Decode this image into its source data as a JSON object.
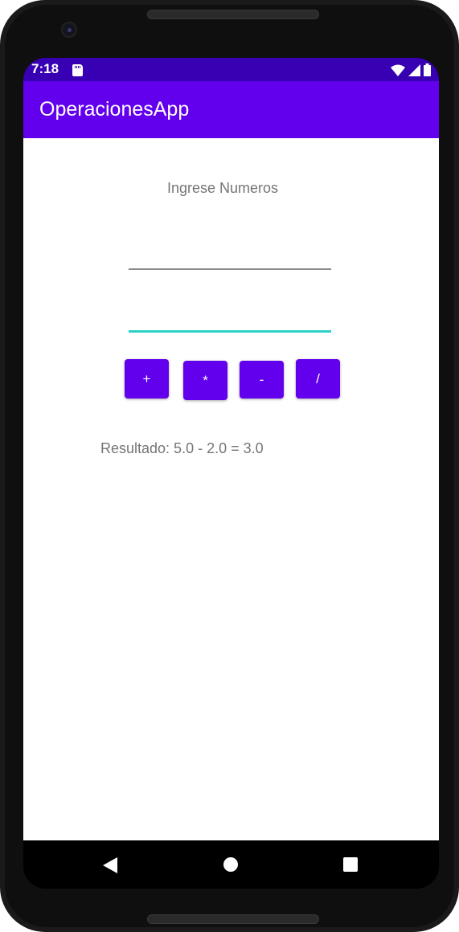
{
  "status_bar": {
    "time": "7:18",
    "icons": [
      "sd-card-icon",
      "wifi-icon",
      "signal-icon",
      "battery-icon"
    ]
  },
  "app_bar": {
    "title": "OperacionesApp"
  },
  "form": {
    "prompt": "Ingrese Numeros",
    "first_number": {
      "value": "",
      "placeholder": ""
    },
    "second_number": {
      "value": "",
      "placeholder": ""
    }
  },
  "buttons": {
    "add": "+",
    "multiply": "*",
    "subtract": "-",
    "divide": "/"
  },
  "result": {
    "text": "Resultado: 5.0 - 2.0 = 3.0"
  },
  "navigation": {
    "icons": [
      "back-icon",
      "home-icon",
      "recents-icon"
    ]
  },
  "colors": {
    "status_bar": "#3700b3",
    "app_bar": "#6200ee",
    "button": "#6200ee",
    "focused_underline": "#2bd0c8"
  }
}
